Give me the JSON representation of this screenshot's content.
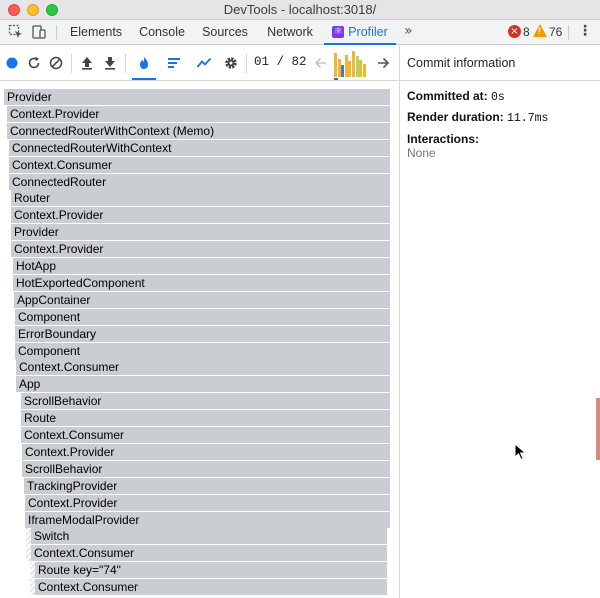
{
  "window": {
    "title": "DevTools - localhost:3018/"
  },
  "tabs": [
    {
      "label": "Elements",
      "active": false
    },
    {
      "label": "Console",
      "active": false
    },
    {
      "label": "Sources",
      "active": false
    },
    {
      "label": "Network",
      "active": false
    },
    {
      "label": "Profiler",
      "active": true
    }
  ],
  "status": {
    "errors": "8",
    "warnings": "76"
  },
  "toolbar": {
    "commit_counter": "01 / 82"
  },
  "commit_bars": [
    {
      "value": 0.92,
      "color": "#f3b72f"
    },
    {
      "value": 0.7,
      "color": "#f3b72f"
    },
    {
      "value": 0.45,
      "color": "#3d7bd9"
    },
    {
      "value": 0.85,
      "color": "#f3b72f"
    },
    {
      "value": 0.62,
      "color": "#f3b72f"
    },
    {
      "value": 1.0,
      "color": "#f3b72f"
    },
    {
      "value": 0.8,
      "color": "#a6d96a"
    },
    {
      "value": 0.66,
      "color": "#f3b72f"
    },
    {
      "value": 0.5,
      "color": "#f3b72f"
    }
  ],
  "flame_rows": [
    "Provider",
    "Context.Provider",
    "ConnectedRouterWithContext (Memo)",
    "ConnectedRouterWithContext",
    "Context.Consumer",
    "ConnectedRouter",
    "Router",
    "Context.Provider",
    "Provider",
    "Context.Provider",
    "HotApp",
    "HotExportedComponent",
    "AppContainer",
    "Component",
    "ErrorBoundary",
    "Component",
    "Context.Consumer",
    "App",
    "ScrollBehavior",
    "Route",
    "Context.Consumer",
    "Context.Provider",
    "ScrollBehavior",
    "TrackingProvider",
    "Context.Provider",
    "IframeModalProvider",
    "Switch",
    "Context.Consumer",
    "Route key=\"74\"",
    "Context.Consumer"
  ],
  "commit_info": {
    "header": "Commit information",
    "committed_label": "Committed at:",
    "committed_value": "0s",
    "render_label": "Render duration:",
    "render_value": "11.7ms",
    "interactions_label": "Interactions:",
    "interactions_value": "None"
  },
  "colors": {
    "accent": "#1a73e8",
    "flame_bar": "#cacdd1"
  }
}
